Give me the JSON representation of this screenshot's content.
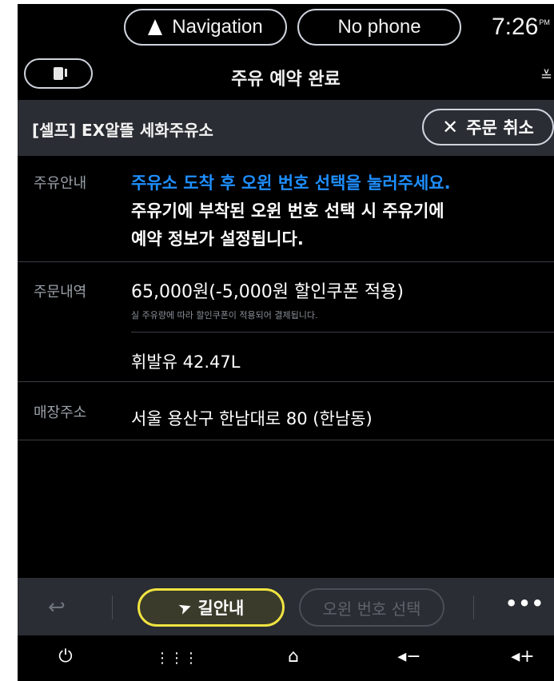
{
  "status_bar": {
    "navigation_label": "Navigation",
    "phone_label": "No phone",
    "time": "7:26",
    "time_suffix": "PM"
  },
  "header": {
    "title": "주유 예약 완료"
  },
  "station": {
    "name": "[셀프] EX알뜰 세화주유소",
    "cancel_label": "주문 취소"
  },
  "fuel_guide": {
    "label": "주유안내",
    "line1": "주유소 도착 후 오윈 번호 선택을 눌러주세요.",
    "line2": "주유기에 부착된 오윈 번호 선택 시 주유기에",
    "line3": "예약 정보가 설정됩니다."
  },
  "order": {
    "label": "주문내역",
    "amount": "65,000원(-5,000원 할인쿠폰 적용)",
    "note": "실 주유량에 따라 할인쿠폰이 적용되어 결제됩니다.",
    "fuel": "휘발유 42.47L"
  },
  "address": {
    "label": "매장주소",
    "value": "서울 용산구 한남대로 80 (한남동)"
  },
  "actions": {
    "guide_label": "길안내",
    "select_label": "오윈 번호 선택",
    "more_label": "•••"
  },
  "colors": {
    "accent_blue": "#1f8fff",
    "highlight_yellow": "#f0e441",
    "panel_gray": "#2a2d33"
  }
}
